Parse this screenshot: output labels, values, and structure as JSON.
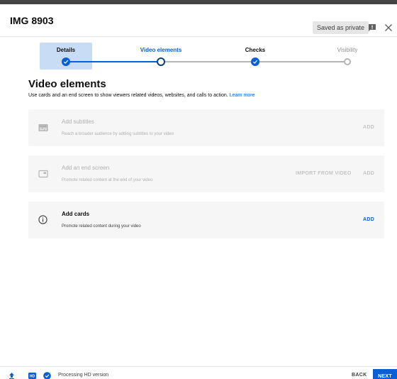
{
  "dialog": {
    "title": "IMG 8903",
    "saved_badge": "Saved as private",
    "icons": {
      "feedback": "feedback-icon",
      "close": "close-icon"
    }
  },
  "stepper": {
    "steps": [
      {
        "label": "Details",
        "state": "done"
      },
      {
        "label": "Video elements",
        "state": "current"
      },
      {
        "label": "Checks",
        "state": "done"
      },
      {
        "label": "Visibility",
        "state": "future"
      }
    ]
  },
  "main": {
    "title": "Video elements",
    "description": "Use cards and an end screen to show viewers related videos, websites, and calls to action.",
    "learn_more": "Learn more",
    "cards": [
      {
        "icon": "subtitles-icon",
        "title": "Add subtitles",
        "description": "Reach a broader audience by adding subtitles to your video",
        "actions": [
          "ADD"
        ],
        "enabled": false
      },
      {
        "icon": "end-screen-icon",
        "title": "Add an end screen",
        "description": "Promote related content at the end of your video",
        "actions": [
          "IMPORT FROM VIDEO",
          "ADD"
        ],
        "enabled": false
      },
      {
        "icon": "info-icon",
        "title": "Add cards",
        "description": "Promote related content during your video",
        "actions": [
          "ADD"
        ],
        "enabled": true
      }
    ]
  },
  "footer": {
    "icons": [
      "upload-icon",
      "hd-icon",
      "check-circle-icon"
    ],
    "status": "Processing HD version",
    "back_label": "BACK",
    "next_label": "NEXT"
  },
  "colors": {
    "accent": "#065fd4",
    "step_highlight": "#c9dcf6",
    "card_bg": "#f6f6f6",
    "disabled_text": "#b0b0b0"
  }
}
